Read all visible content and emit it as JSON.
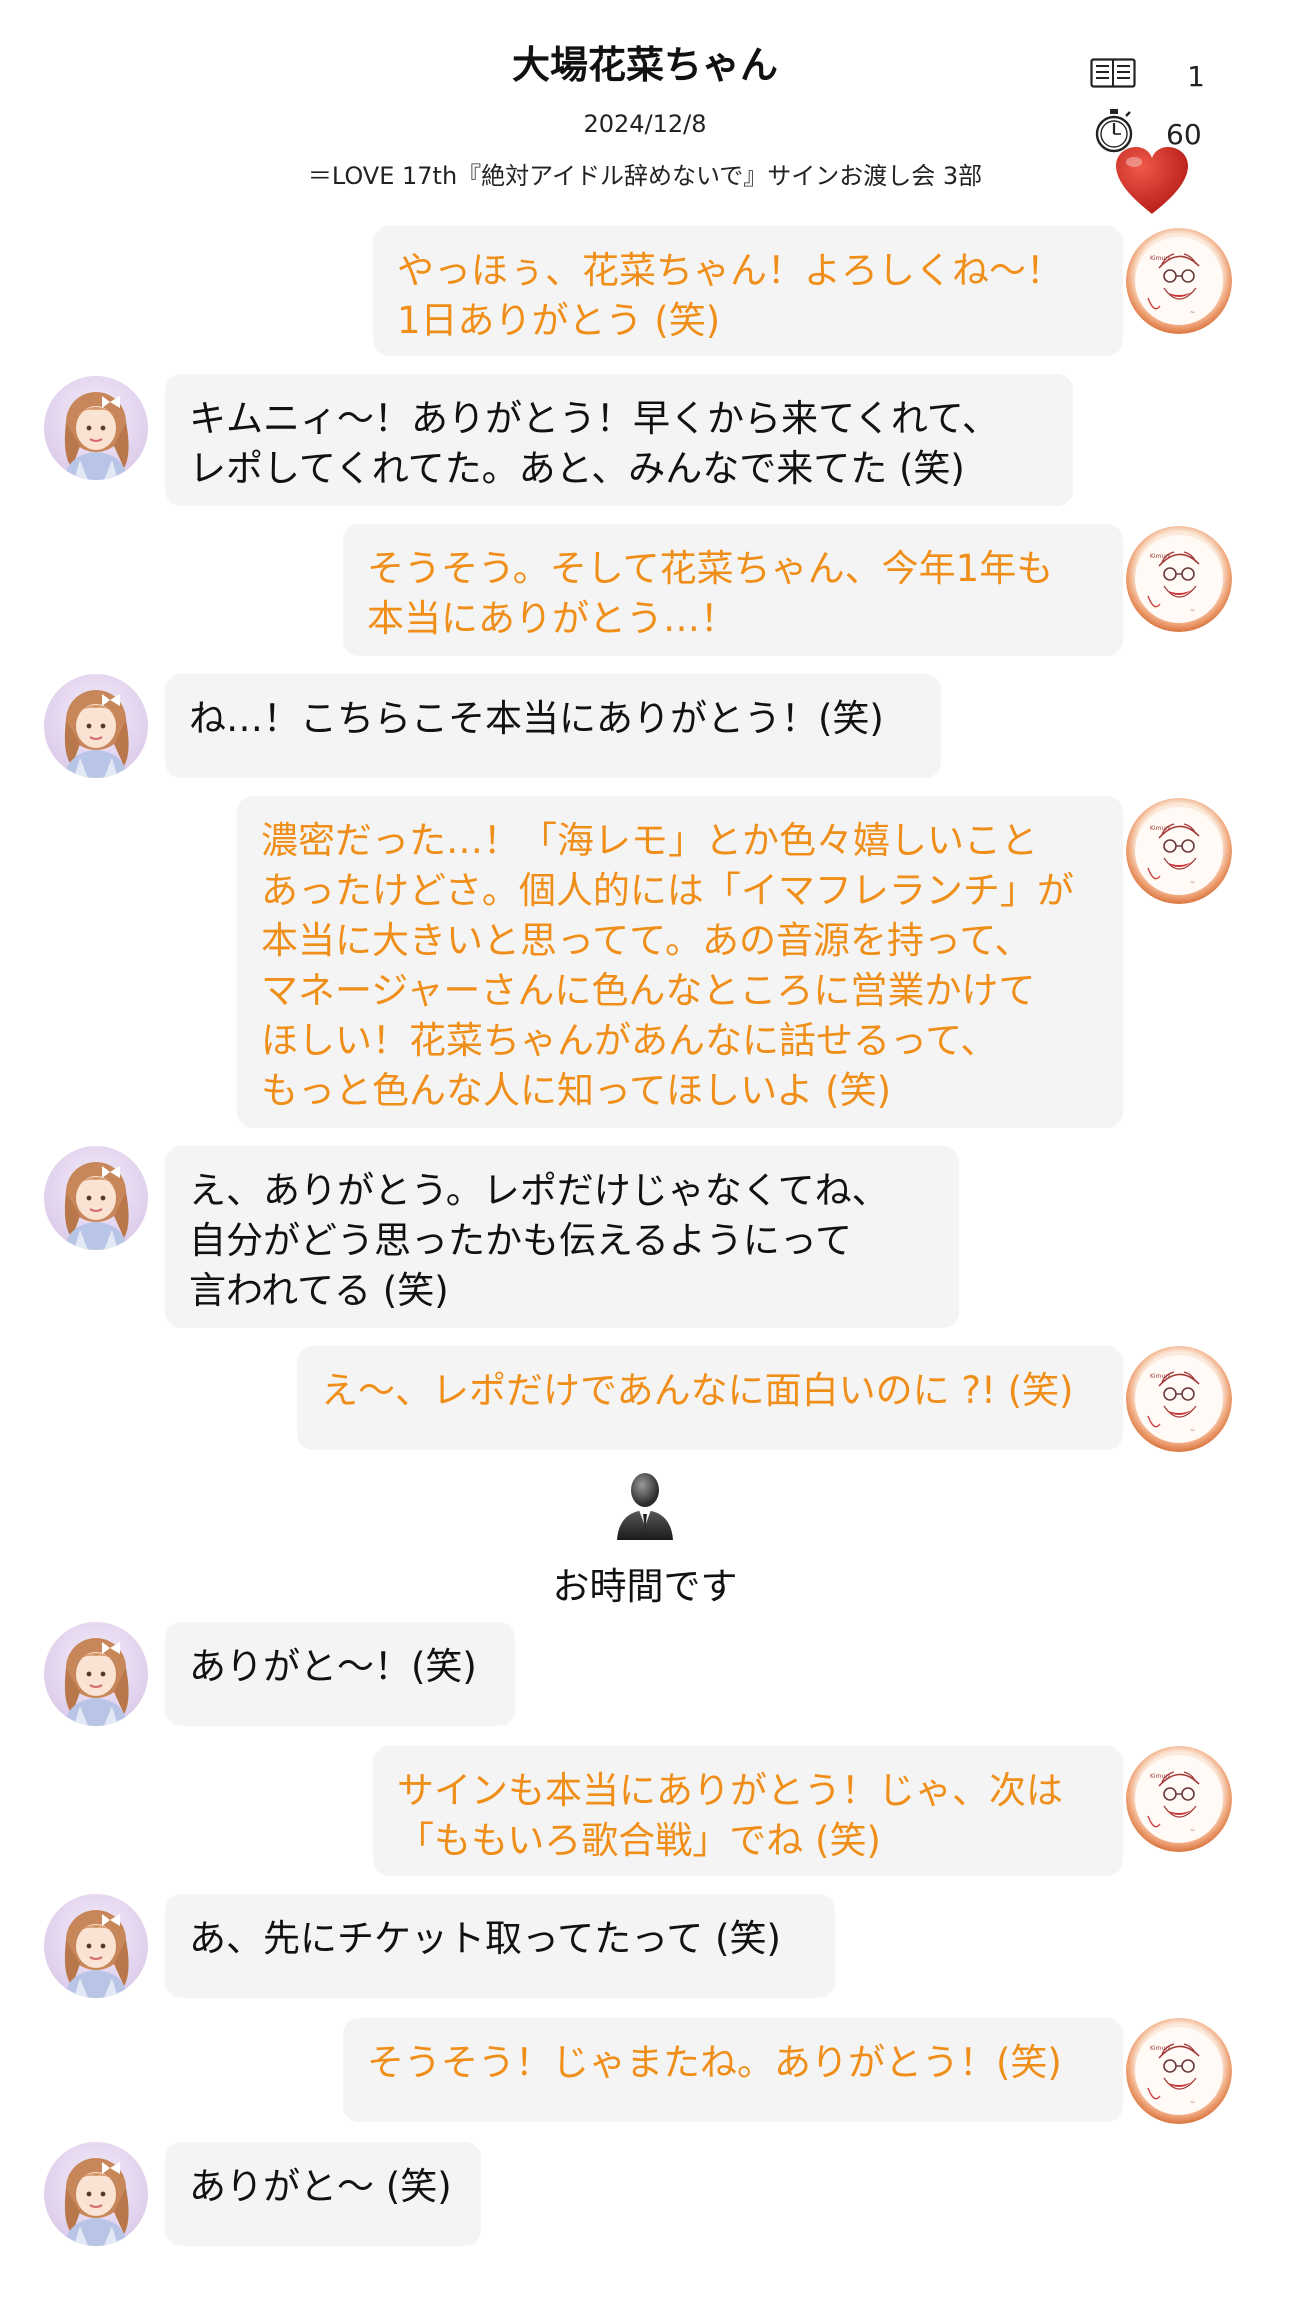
{
  "header": {
    "title": "大場花菜ちゃん",
    "date": "2024/12/8",
    "event": "＝LOVE 17th『絶対アイドル辞めないで』サインお渡し会 3部",
    "pages_count": "1",
    "time_value": "60"
  },
  "icons": {
    "pages": "book-icon",
    "timer": "stopwatch-icon",
    "heart": "heart-icon",
    "staff": "staff-person-icon"
  },
  "colors": {
    "mine_text": "#f08e1a",
    "bubble_bg": "#f4f4f4",
    "heart": "#d0342c"
  },
  "messages": [
    {
      "sender": "me",
      "text": "やっほぅ、花菜ちゃん！よろしくね〜！\n1日ありがとう (笑)"
    },
    {
      "sender": "her",
      "text": "キムニィ〜！ありがとう！早くから来てくれて、\nレポしてくれてた。あと、みんなで来てた (笑)"
    },
    {
      "sender": "me",
      "text": "そうそう。そして花菜ちゃん、今年1年も\n本当にありがとう…！"
    },
    {
      "sender": "her",
      "text": "ね…！こちらこそ本当にありがとう！(笑)"
    },
    {
      "sender": "me",
      "text": "濃密だった…！「海レモ」とか色々嬉しいこと\nあったけどさ。個人的には「イマフレランチ」が\n本当に大きいと思ってて。あの音源を持って、\nマネージャーさんに色んなところに営業かけて\nほしい！花菜ちゃんがあんなに話せるって、\nもっと色んな人に知ってほしいよ (笑)"
    },
    {
      "sender": "her",
      "text": "え、ありがとう。レポだけじゃなくてね、\n自分がどう思ったかも伝えるようにって\n言われてる (笑)"
    },
    {
      "sender": "me",
      "text": "え〜、レポだけであんなに面白いのに ?! (笑)"
    },
    {
      "sender": "her",
      "text": "ありがと〜！(笑)"
    },
    {
      "sender": "me",
      "text": "サインも本当にありがとう！じゃ、次は\n「ももいろ歌合戦」でね (笑)"
    },
    {
      "sender": "her",
      "text": "あ、先にチケット取ってたって (笑)"
    },
    {
      "sender": "me",
      "text": "そうそう！じゃまたね。ありがとう！(笑)"
    },
    {
      "sender": "her",
      "text": "ありがと〜 (笑)"
    }
  ],
  "staff_notice": "お時間です"
}
